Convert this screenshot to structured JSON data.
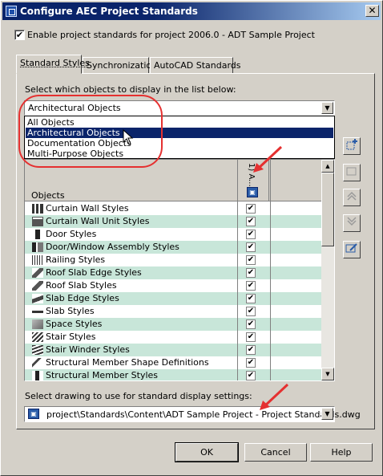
{
  "window": {
    "title": "Configure AEC Project Standards",
    "close_glyph": "✕"
  },
  "enable": {
    "checked_glyph": "✔",
    "label": "Enable project standards for project 2006.0 - ADT Sample Project"
  },
  "tabs": [
    {
      "label": "Standard Styles",
      "active": true
    },
    {
      "label": "Synchronization",
      "active": false
    },
    {
      "label": "AutoCAD Standards",
      "active": false
    }
  ],
  "prompt": "Select which objects to display in the list below:",
  "object_filter": {
    "value": "Architectural Objects",
    "options": [
      "All Objects",
      "Architectural Objects",
      "Documentation Objects",
      "Multi-Purpose Objects"
    ],
    "selected_index": 1
  },
  "grid": {
    "column_objects": "Objects",
    "column_check": "1) A...",
    "column_icon_glyph": "▣",
    "check_glyph": "✔",
    "rows": [
      "Curtain Wall Styles",
      "Curtain Wall Unit Styles",
      "Door Styles",
      "Door/Window Assembly Styles",
      "Railing Styles",
      "Roof Slab Edge Styles",
      "Roof Slab Styles",
      "Slab Edge Styles",
      "Slab Styles",
      "Space Styles",
      "Stair Styles",
      "Stair Winder Styles",
      "Structural Member Shape Definitions",
      "Structural Member Styles"
    ]
  },
  "side_buttons": [
    "add",
    "remove",
    "move-up",
    "move-down",
    "edit"
  ],
  "drawing": {
    "label": "Select drawing to use for standard display settings:",
    "icon_glyph": "▣",
    "value": "project\\Standards\\Content\\ADT Sample Project - Project Standards.dwg"
  },
  "buttons": {
    "ok": "OK",
    "cancel": "Cancel",
    "help": "Help"
  },
  "glyphs": {
    "dropdown_arrow": "▼",
    "scroll_up": "▲",
    "scroll_down": "▼"
  },
  "annotation_color": "#e53030"
}
